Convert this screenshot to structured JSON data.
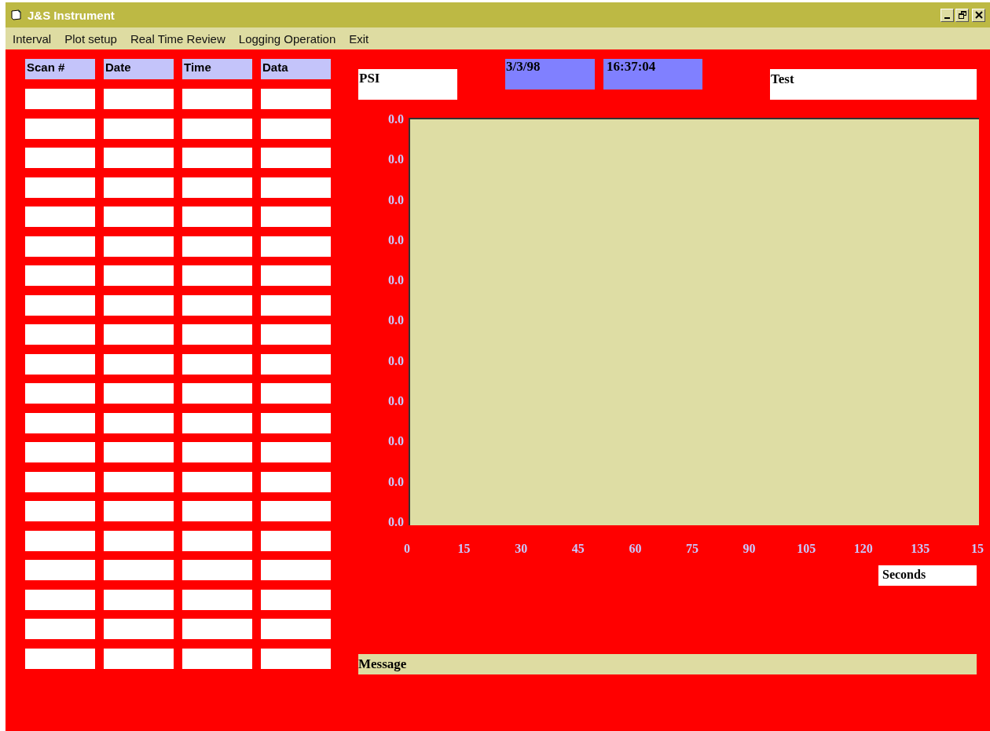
{
  "window": {
    "title": "J&S Instrument"
  },
  "menu": [
    "Interval",
    "Plot setup",
    "Real Time Review",
    "Logging Operation",
    "Exit"
  ],
  "table": {
    "columns": [
      "Scan #",
      "Date",
      "Time",
      "Data"
    ],
    "rows": [
      {
        "kind": "blank"
      },
      {
        "kind": "blank"
      },
      {
        "kind": "blank"
      },
      {
        "kind": "blank"
      },
      {
        "kind": "blank"
      },
      {
        "kind": "blank"
      },
      {
        "kind": "blank"
      },
      {
        "kind": "blank"
      },
      {
        "kind": "blank"
      },
      {
        "kind": "blank"
      },
      {
        "kind": "blank"
      },
      {
        "kind": "blank"
      },
      {
        "kind": "blank"
      },
      {
        "kind": "blank"
      },
      {
        "kind": "blank"
      },
      {
        "kind": "blank"
      },
      {
        "kind": "blank"
      },
      {
        "kind": "blank"
      },
      {
        "kind": "blank"
      },
      {
        "kind": "blank"
      }
    ]
  },
  "plot": {
    "unit_label": "PSI",
    "date": "3/3/98",
    "time": "16:37:04",
    "title": "Test",
    "y_labels": [
      "0.0",
      "0.0",
      "0.0",
      "0.0",
      "0.0",
      "0.0",
      "0.0",
      "0.0",
      "0.0",
      "0.0",
      "0.0"
    ],
    "x_labels": [
      "0",
      "15",
      "30",
      "45",
      "60",
      "75",
      "90",
      "105",
      "120",
      "135",
      "15"
    ],
    "x_unit": "Seconds"
  },
  "message_label": "Message"
}
